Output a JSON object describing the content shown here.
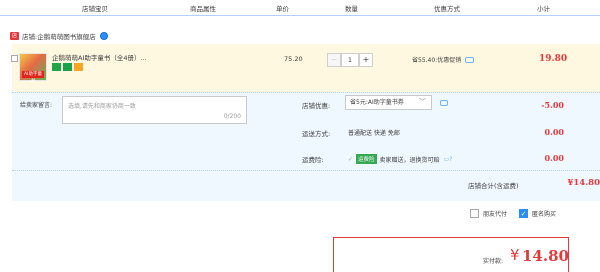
{
  "header": {
    "shop_info": "店铺宝贝",
    "attributes": "商品属性",
    "unit_price": "单价",
    "quantity": "数量",
    "discount": "优惠方式",
    "subtotal": "小计"
  },
  "shop": {
    "icon_label": "店",
    "label": "店铺:",
    "name": "企鹅萌萌图书旗舰店"
  },
  "item": {
    "thumb_text": "AI助字童书",
    "title": "企鹅萌萌AI助字童书（全4册）...",
    "price": "75.20",
    "quantity": "1",
    "minus": "−",
    "plus": "+",
    "promo": "省55.40:优惠促销",
    "subtotal": "19.80"
  },
  "message": {
    "label": "给卖家留言:",
    "placeholder": "选填,请先和商家协商一致",
    "counter": "0/200"
  },
  "coupon": {
    "label": "店铺优惠:",
    "selected": "省5元:AI助字童书券",
    "value": "-5.00"
  },
  "shipping": {
    "label": "运送方式:",
    "value": "普通配送 快递 免邮",
    "price": "0.00"
  },
  "insurance": {
    "label": "运费险:",
    "check": "✓",
    "tag": "运费险",
    "text": "卖家赠送，退换货可赔",
    "price": "0.00"
  },
  "total": {
    "label": "店铺合计(含运费)",
    "value": "¥14.80"
  },
  "options": {
    "friend_pay": "朋友代付",
    "anonymous": "匿名购买",
    "check": "✓"
  },
  "payment": {
    "label": "实付款:",
    "currency": "¥",
    "amount": "14.80"
  },
  "colors": {
    "accent": "#e4393c",
    "link_blue": "#2a8ff7",
    "item_bg": "#fff8e1",
    "lower_bg": "#f0f8ff"
  }
}
